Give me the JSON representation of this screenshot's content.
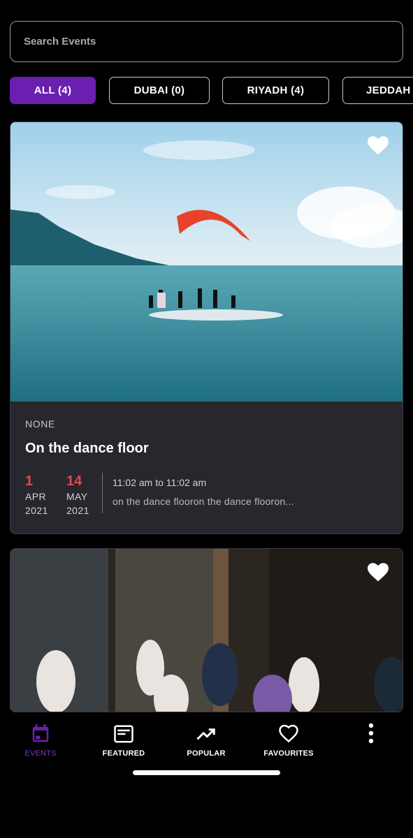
{
  "search": {
    "placeholder": "Search Events",
    "value": ""
  },
  "filters": [
    {
      "label": "ALL (4)",
      "active": true
    },
    {
      "label": "DUBAI (0)",
      "active": false
    },
    {
      "label": "RIYADH (4)",
      "active": false
    },
    {
      "label": "JEDDAH",
      "active": false
    }
  ],
  "events": [
    {
      "category": "NONE",
      "title": "On the dance floor",
      "start": {
        "day": "1",
        "month": "APR",
        "year": "2021"
      },
      "end": {
        "day": "14",
        "month": "MAY",
        "year": "2021"
      },
      "time": "11:02 am to 11:02 am",
      "description": "on the dance flooron the dance flooron...",
      "favourite_icon": "heart-icon",
      "image": "paragliding-over-lake-photo"
    },
    {
      "favourite_icon": "heart-icon",
      "image": "yoga-class-photo"
    }
  ],
  "tabbar": {
    "events": "EVENTS",
    "featured": "FEATURED",
    "popular": "POPULAR",
    "favourites": "FAVOURITES",
    "more_icon": "more-vertical-icon"
  },
  "colors": {
    "accent": "#6a1fb0",
    "date_red": "#e0484f",
    "card_bg": "#27272d"
  }
}
